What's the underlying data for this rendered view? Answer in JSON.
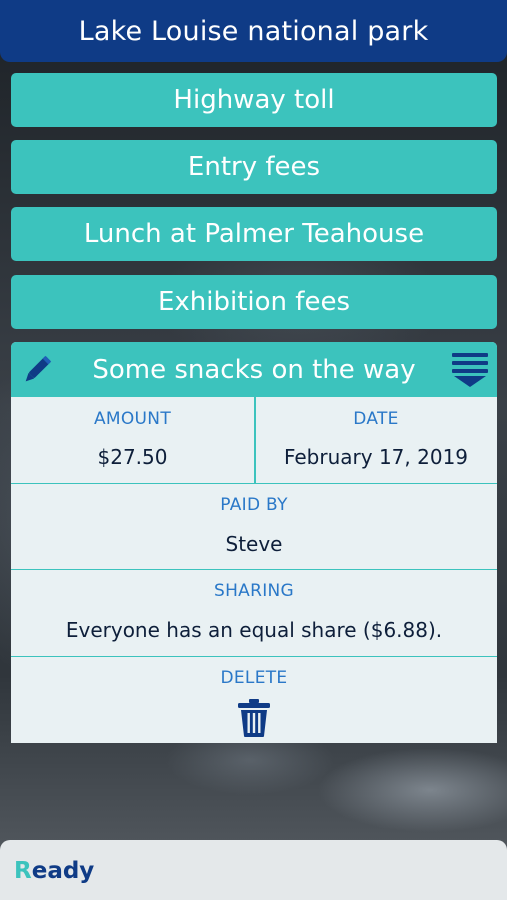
{
  "header": {
    "title": "Lake Louise national park"
  },
  "expenses": [
    {
      "label": "Highway toll"
    },
    {
      "label": "Entry fees"
    },
    {
      "label": "Lunch at Palmer Teahouse"
    },
    {
      "label": "Exhibition fees"
    }
  ],
  "detail": {
    "title": "Some snacks on the way",
    "amount_label": "AMOUNT",
    "amount": "$27.50",
    "date_label": "DATE",
    "date": "February 17, 2019",
    "paid_by_label": "PAID BY",
    "paid_by": "Steve",
    "sharing_label": "SHARING",
    "sharing": "Everyone has an equal share ($6.88).",
    "delete_label": "DELETE",
    "icons": {
      "edit": "pencil-icon",
      "menu": "menu-collapse-icon",
      "delete": "trash-icon"
    }
  },
  "status": {
    "first_letter": "R",
    "rest": "eady"
  },
  "colors": {
    "header": "#0f3b86",
    "accent": "#3cc3bd",
    "label": "#2a78c8",
    "card": "#e9f1f3"
  }
}
